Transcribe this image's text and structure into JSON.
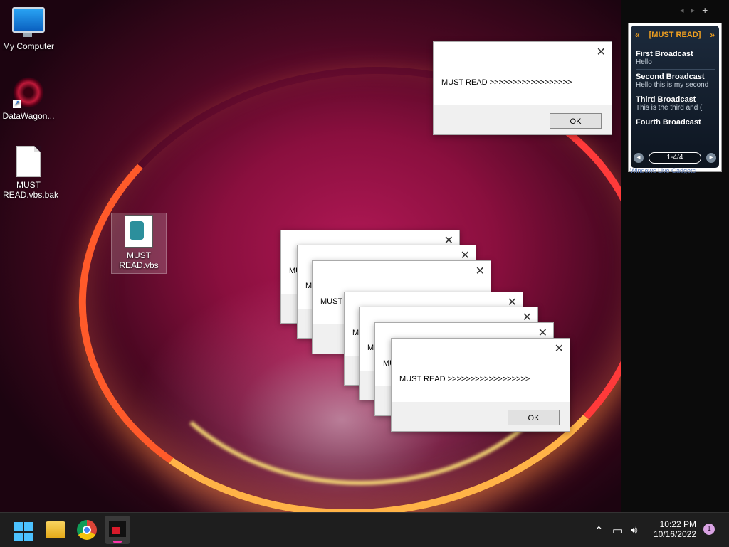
{
  "desktop": {
    "icons": [
      {
        "label": "My Computer"
      },
      {
        "label": "DataWagon..."
      },
      {
        "label": "MUST READ.vbs.bak"
      },
      {
        "label": "MUST READ.vbs"
      }
    ]
  },
  "dialogs": {
    "message": "MUST READ >>>>>>>>>>>>>>>>>>",
    "ok_label": "OK",
    "partial_label": "MUST"
  },
  "gadget": {
    "title": "[MUST READ]",
    "prev_arrow": "«",
    "next_arrow": "»",
    "items": [
      {
        "title": "First Broadcast",
        "text": "Hello"
      },
      {
        "title": "Second Broadcast",
        "text": "Hello this is my second"
      },
      {
        "title": "Third Broadcast",
        "text": "This is the third and (i"
      },
      {
        "title": "Fourth Broadcast",
        "text": ""
      }
    ],
    "page": "1-4/4",
    "footer": "Windows Live Gadgets"
  },
  "sidebar": {
    "add": "+"
  },
  "taskbar": {
    "time": "10:22 PM",
    "date": "10/16/2022",
    "notifications": "1"
  },
  "colors": {
    "accent": "#4cc2ff",
    "gadget_title": "#f0a020"
  }
}
